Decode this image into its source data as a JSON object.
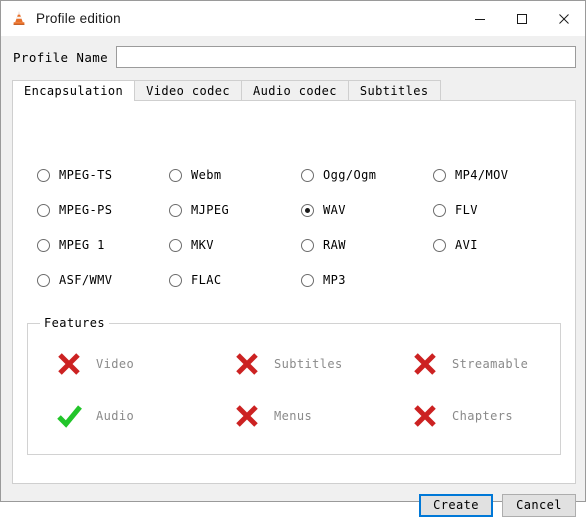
{
  "window": {
    "title": "Profile edition",
    "app_icon": "vlc-cone-icon",
    "controls": {
      "minimize": "minimize-icon",
      "maximize": "maximize-icon",
      "close": "close-icon"
    }
  },
  "profile": {
    "label": "Profile Name",
    "value": "",
    "placeholder": ""
  },
  "tabs": [
    {
      "label": "Encapsulation",
      "active": true
    },
    {
      "label": "Video codec",
      "active": false
    },
    {
      "label": "Audio codec",
      "active": false
    },
    {
      "label": "Subtitles",
      "active": false
    }
  ],
  "encapsulation": {
    "selected": "WAV",
    "options": [
      {
        "label": "MPEG-TS",
        "checked": false,
        "col": 0,
        "row": 0
      },
      {
        "label": "MPEG-PS",
        "checked": false,
        "col": 0,
        "row": 1
      },
      {
        "label": "MPEG 1",
        "checked": false,
        "col": 0,
        "row": 2
      },
      {
        "label": "ASF/WMV",
        "checked": false,
        "col": 0,
        "row": 3
      },
      {
        "label": "Webm",
        "checked": false,
        "col": 1,
        "row": 0
      },
      {
        "label": "MJPEG",
        "checked": false,
        "col": 1,
        "row": 1
      },
      {
        "label": "MKV",
        "checked": false,
        "col": 1,
        "row": 2
      },
      {
        "label": "FLAC",
        "checked": false,
        "col": 1,
        "row": 3
      },
      {
        "label": "Ogg/Ogm",
        "checked": false,
        "col": 2,
        "row": 0
      },
      {
        "label": "WAV",
        "checked": true,
        "col": 2,
        "row": 1
      },
      {
        "label": "RAW",
        "checked": false,
        "col": 2,
        "row": 2
      },
      {
        "label": "MP3",
        "checked": false,
        "col": 2,
        "row": 3
      },
      {
        "label": "MP4/MOV",
        "checked": false,
        "col": 3,
        "row": 0
      },
      {
        "label": "FLV",
        "checked": false,
        "col": 3,
        "row": 1
      },
      {
        "label": "AVI",
        "checked": false,
        "col": 3,
        "row": 2
      }
    ]
  },
  "features": {
    "legend": "Features",
    "items": [
      {
        "label": "Video",
        "state": "no",
        "col": 0,
        "row": 0
      },
      {
        "label": "Audio",
        "state": "yes",
        "col": 0,
        "row": 1
      },
      {
        "label": "Subtitles",
        "state": "no",
        "col": 1,
        "row": 0
      },
      {
        "label": "Menus",
        "state": "no",
        "col": 1,
        "row": 1
      },
      {
        "label": "Streamable",
        "state": "no",
        "col": 2,
        "row": 0
      },
      {
        "label": "Chapters",
        "state": "no",
        "col": 2,
        "row": 1
      }
    ]
  },
  "footer": {
    "create_label": "Create",
    "cancel_label": "Cancel"
  },
  "colors": {
    "accent": "#0078d7",
    "cross": "#cc2222",
    "check": "#22c52a",
    "dialog_bg": "#f0f0f0",
    "panel_bg": "#ffffff"
  }
}
